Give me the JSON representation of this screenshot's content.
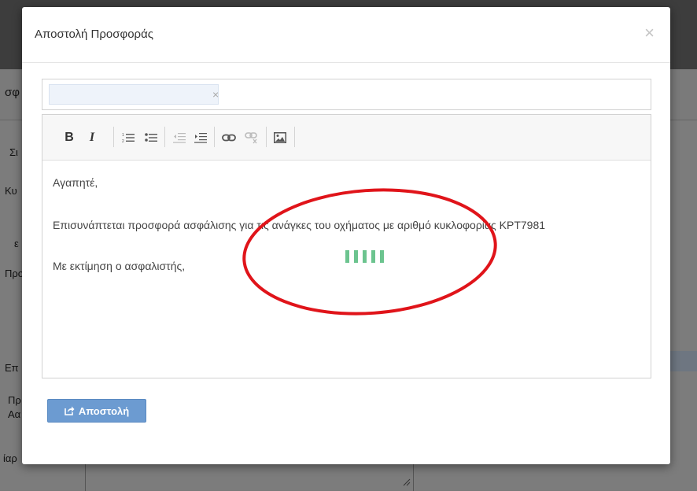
{
  "background": {
    "header_fragment": "σφ",
    "labels": [
      "Σι",
      "Κυ",
      "ε",
      "Προ",
      "Επ",
      "Πρ",
      "Αα",
      "ίαρ"
    ]
  },
  "modal": {
    "title": "Αποστολή Προσφοράς",
    "close_glyph": "×",
    "recipient": {
      "remove_glyph": "×"
    },
    "toolbar": {
      "bold": "B",
      "italic": "I",
      "ordered_list": "ordered-list-icon",
      "unordered_list": "unordered-list-icon",
      "outdent": "outdent-icon",
      "indent": "indent-icon",
      "link": "link-icon",
      "unlink": "unlink-icon",
      "image": "image-icon"
    },
    "body": {
      "greeting": "Αγαπητέ,",
      "message": "Επισυνάπτεται προσφορά ασφάλισης για τις ανάγκες του οχήματος με αριθμό κυκλοφορίας ΚΡΤ7981",
      "signoff": "Με εκτίμηση ο ασφαλιστής,"
    },
    "send_button": {
      "label": "Αποστολή",
      "icon": "share-icon"
    }
  },
  "colors": {
    "send_button": "#6c9bd1",
    "loader": "#6cc48f",
    "annotation": "#e0141a"
  }
}
